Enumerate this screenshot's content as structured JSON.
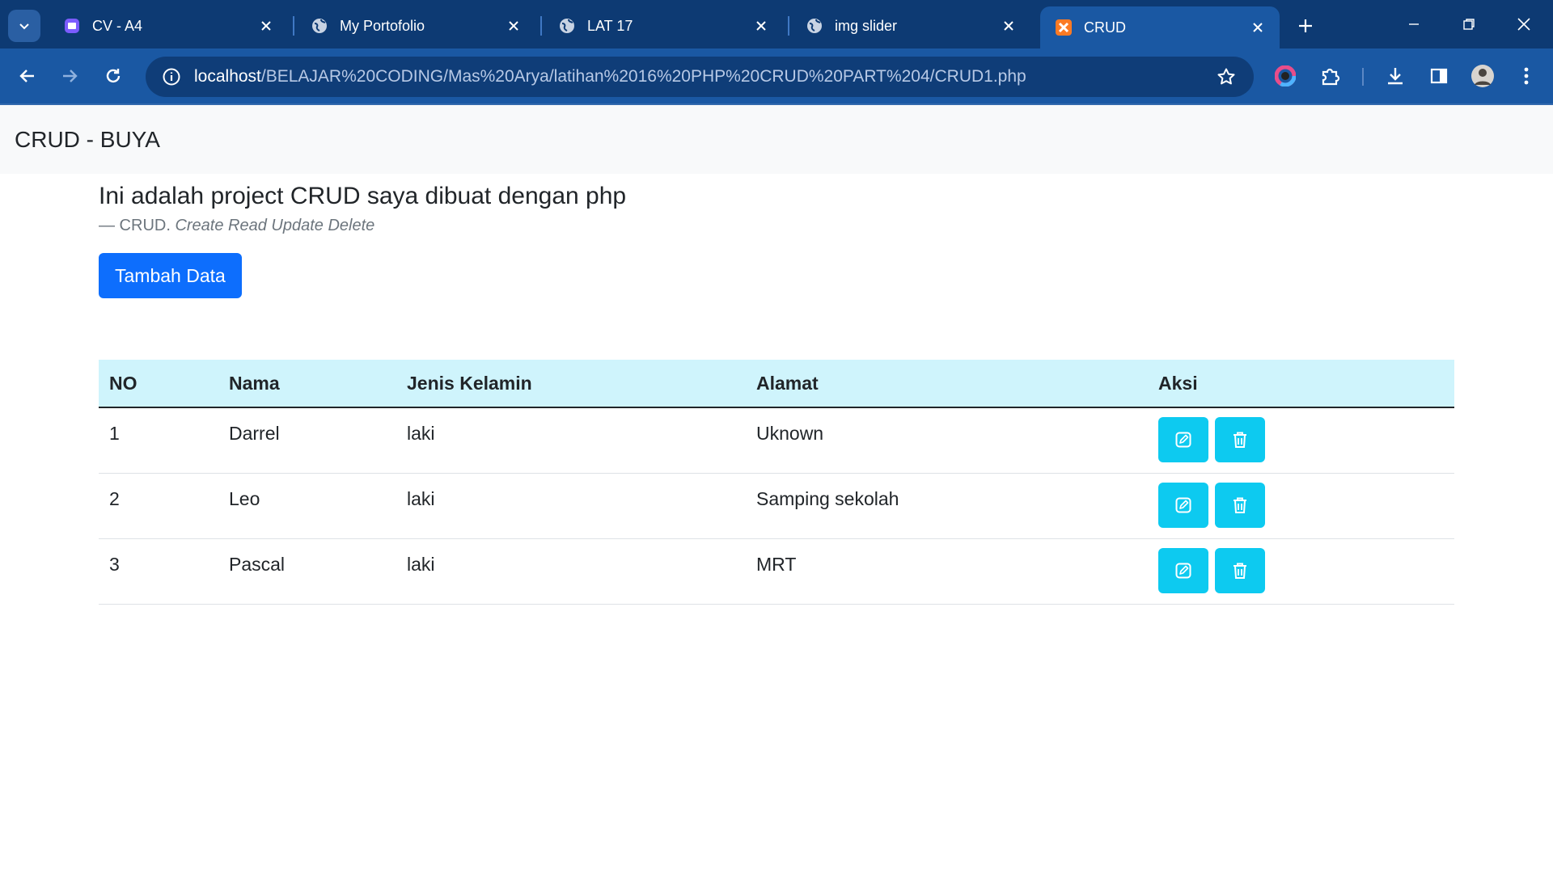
{
  "browser": {
    "tabs": [
      {
        "title": "CV - A4",
        "favicon": "cv-app-icon",
        "active": false
      },
      {
        "title": "My Portofolio",
        "favicon": "globe-icon",
        "active": false
      },
      {
        "title": "LAT 17",
        "favicon": "globe-icon",
        "active": false
      },
      {
        "title": "img slider",
        "favicon": "globe-icon",
        "active": false
      },
      {
        "title": "CRUD",
        "favicon": "xampp-icon",
        "active": true
      }
    ],
    "url_host": "localhost",
    "url_path": "/BELAJAR%20CODING/Mas%20Arya/latihan%2016%20PHP%20CRUD%20PART%204/CRUD1.php",
    "colors": {
      "tabstrip": "#0d3a73",
      "toolbar": "#1a58a3",
      "omnibox": "#0f3d78"
    }
  },
  "navbar": {
    "brand": "CRUD - BUYA"
  },
  "page": {
    "heading": "Ini adalah project CRUD saya dibuat dengan php",
    "footer_prefix": "— CRUD.",
    "footer_cite": "Create Read Update Delete",
    "add_button": "Tambah Data"
  },
  "table": {
    "headers": [
      "NO",
      "Nama",
      "Jenis Kelamin",
      "Alamat",
      "Aksi"
    ],
    "rows": [
      {
        "no": "1",
        "nama": "Darrel",
        "jk": "laki",
        "alamat": "Uknown"
      },
      {
        "no": "2",
        "nama": "Leo",
        "jk": "laki",
        "alamat": "Samping sekolah"
      },
      {
        "no": "3",
        "nama": "Pascal",
        "jk": "laki",
        "alamat": "MRT"
      }
    ],
    "actions": [
      "edit-icon",
      "trash-icon"
    ],
    "colors": {
      "header_bg": "#cff4fc",
      "action_btn": "#0dcaf0",
      "primary": "#0d6efd"
    }
  }
}
